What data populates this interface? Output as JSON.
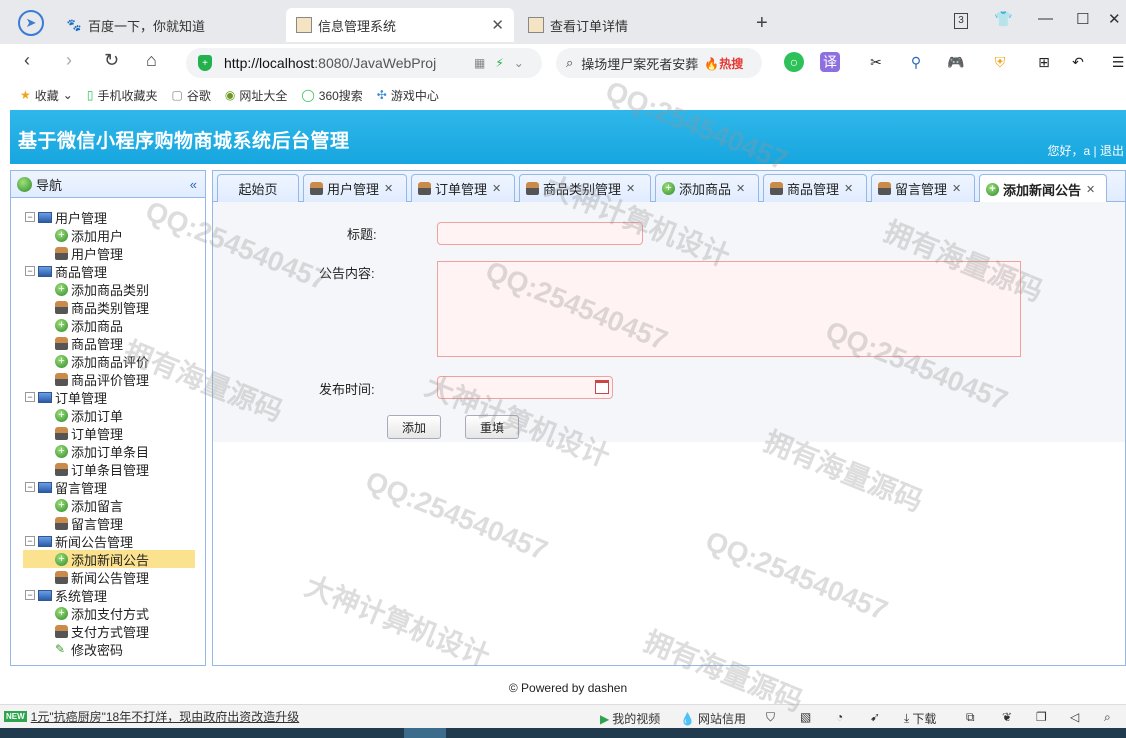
{
  "browser": {
    "tabs": [
      {
        "label": "百度一下，你就知道",
        "icon": "paw-icon"
      },
      {
        "label": "信息管理系统",
        "icon": "page-icon"
      },
      {
        "label": "查看订单详情",
        "icon": "page-icon"
      }
    ],
    "tab_count": "3",
    "url_host": "http://localhost",
    "url_rest": ":8080/JavaWebProj",
    "search_text": "操场埋尸案死者安葬",
    "search_hot": "热搜",
    "bookmarks": [
      "收藏",
      "手机收藏夹",
      "谷歌",
      "网址大全",
      "360搜索",
      "游戏中心"
    ]
  },
  "app": {
    "title": "基于微信小程序购物商城系统后台管理",
    "user_greeting": "您好，a",
    "logout_label": "退出"
  },
  "sidebar": {
    "title": "导航",
    "collapse_glyph": "«",
    "groups": [
      {
        "label": "用户管理",
        "items": [
          "添加用户",
          "用户管理"
        ]
      },
      {
        "label": "商品管理",
        "items": [
          "添加商品类别",
          "商品类别管理",
          "添加商品",
          "商品管理",
          "添加商品评价",
          "商品评价管理"
        ]
      },
      {
        "label": "订单管理",
        "items": [
          "添加订单",
          "订单管理",
          "添加订单条目",
          "订单条目管理"
        ]
      },
      {
        "label": "留言管理",
        "items": [
          "添加留言",
          "留言管理"
        ]
      },
      {
        "label": "新闻公告管理",
        "items": [
          "添加新闻公告",
          "新闻公告管理"
        ]
      },
      {
        "label": "系统管理",
        "items": [
          "添加支付方式",
          "支付方式管理",
          "修改密码"
        ]
      }
    ],
    "selected_item": "添加新闻公告"
  },
  "content_tabs": [
    {
      "label": "起始页",
      "closable": false
    },
    {
      "label": "用户管理",
      "closable": true
    },
    {
      "label": "订单管理",
      "closable": true
    },
    {
      "label": "商品类别管理",
      "closable": true
    },
    {
      "label": "添加商品",
      "closable": true
    },
    {
      "label": "商品管理",
      "closable": true
    },
    {
      "label": "留言管理",
      "closable": true
    },
    {
      "label": "添加新闻公告",
      "closable": true
    }
  ],
  "form": {
    "title_label": "标题:",
    "title_value": "",
    "content_label": "公告内容:",
    "content_value": "",
    "publish_time_label": "发布时间:",
    "publish_time_value": "",
    "submit_label": "添加",
    "reset_label": "重填"
  },
  "footer": {
    "text": "© Powered by dashen"
  },
  "statusbar": {
    "news_badge": "NEW",
    "news_text": "1元\"抗癌厨房\"18年不打烊，现由政府出资改造升级",
    "my_video": "我的视频",
    "site_credit": "网站信用",
    "download": "下载"
  },
  "watermarks": [
    "QQ:254540457",
    "大神计算机设计",
    "拥有海量源码"
  ],
  "colors": {
    "header": "#1ea9e1",
    "panel_border": "#95b8e7",
    "selected": "#fbe28e",
    "input_border": "#f1a0a0"
  }
}
